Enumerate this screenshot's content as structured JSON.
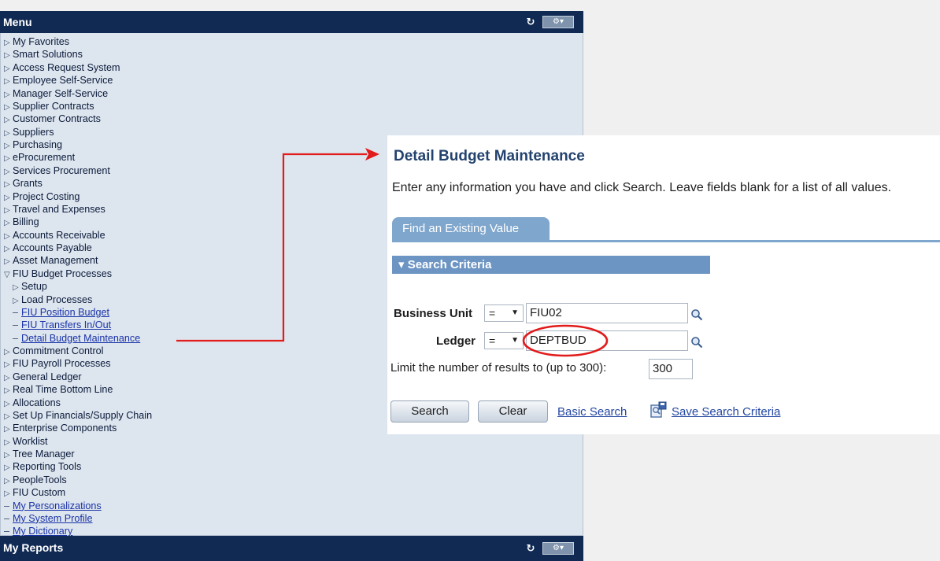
{
  "menu": {
    "title": "Menu",
    "items": [
      {
        "label": "My Favorites",
        "kind": "folder"
      },
      {
        "label": "Smart Solutions",
        "kind": "folder"
      },
      {
        "label": "Access Request System",
        "kind": "folder"
      },
      {
        "label": "Employee Self-Service",
        "kind": "folder"
      },
      {
        "label": "Manager Self-Service",
        "kind": "folder"
      },
      {
        "label": "Supplier Contracts",
        "kind": "folder"
      },
      {
        "label": "Customer Contracts",
        "kind": "folder"
      },
      {
        "label": "Suppliers",
        "kind": "folder"
      },
      {
        "label": "Purchasing",
        "kind": "folder"
      },
      {
        "label": "eProcurement",
        "kind": "folder"
      },
      {
        "label": "Services Procurement",
        "kind": "folder"
      },
      {
        "label": "Grants",
        "kind": "folder"
      },
      {
        "label": "Project Costing",
        "kind": "folder"
      },
      {
        "label": "Travel and Expenses",
        "kind": "folder"
      },
      {
        "label": "Billing",
        "kind": "folder"
      },
      {
        "label": "Accounts Receivable",
        "kind": "folder"
      },
      {
        "label": "Accounts Payable",
        "kind": "folder"
      },
      {
        "label": "Asset Management",
        "kind": "folder"
      },
      {
        "label": "FIU Budget Processes",
        "kind": "open"
      },
      {
        "label": "Setup",
        "kind": "subfolder"
      },
      {
        "label": "Load Processes",
        "kind": "subfolder"
      },
      {
        "label": "FIU Position Budget",
        "kind": "sublink"
      },
      {
        "label": "FIU Transfers In/Out",
        "kind": "sublink"
      },
      {
        "label": "Detail Budget Maintenance",
        "kind": "sublink"
      },
      {
        "label": "Commitment Control",
        "kind": "folder"
      },
      {
        "label": "FIU Payroll Processes",
        "kind": "folder"
      },
      {
        "label": "General Ledger",
        "kind": "folder"
      },
      {
        "label": "Real Time Bottom Line",
        "kind": "folder"
      },
      {
        "label": "Allocations",
        "kind": "folder"
      },
      {
        "label": "Set Up Financials/Supply Chain",
        "kind": "folder"
      },
      {
        "label": "Enterprise Components",
        "kind": "folder"
      },
      {
        "label": "Worklist",
        "kind": "folder"
      },
      {
        "label": "Tree Manager",
        "kind": "folder"
      },
      {
        "label": "Reporting Tools",
        "kind": "folder"
      },
      {
        "label": "PeopleTools",
        "kind": "folder"
      },
      {
        "label": "FIU Custom",
        "kind": "folder"
      },
      {
        "label": "My Personalizations",
        "kind": "link"
      },
      {
        "label": "My System Profile",
        "kind": "link"
      },
      {
        "label": "My Dictionary",
        "kind": "link"
      }
    ]
  },
  "reports": {
    "title": "My Reports"
  },
  "page": {
    "title": "Detail Budget Maintenance",
    "instructions": "Enter any information you have and click Search. Leave fields blank for a list of all values.",
    "tab_label": "Find an Existing Value",
    "section_label": "Search Criteria",
    "business_unit": {
      "label": "Business Unit",
      "operator": "=",
      "value": "FIU02"
    },
    "ledger": {
      "label": "Ledger",
      "operator": "=",
      "value": "DEPTBUD"
    },
    "limit": {
      "label": "Limit the number of results to (up to 300):",
      "value": "300"
    },
    "search_label": "Search",
    "clear_label": "Clear",
    "basic_search_label": "Basic Search",
    "save_criteria_label": "Save Search Criteria"
  },
  "colors": {
    "header": "#102a54",
    "annotation": "#e21b1b",
    "tab": "#7fa6cc"
  },
  "icons": [
    "refresh-icon",
    "options-icon",
    "triangle-right-icon",
    "triangle-down-icon",
    "magnifier-icon",
    "save-criteria-icon"
  ]
}
